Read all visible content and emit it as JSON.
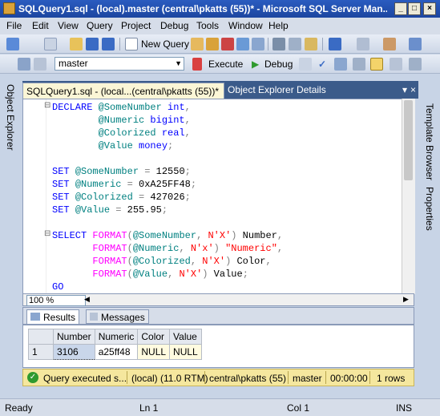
{
  "window": {
    "title": "SQLQuery1.sql - (local).master (central\\pkatts (55))* - Microsoft SQL Server Man..."
  },
  "menu": [
    "File",
    "Edit",
    "View",
    "Query",
    "Project",
    "Debug",
    "Tools",
    "Window",
    "Help"
  ],
  "toolbar": {
    "new_query_label": "New Query",
    "database": "master",
    "execute_label": "Execute",
    "debug_label": "Debug"
  },
  "side_tabs": {
    "object_explorer": "Object Explorer",
    "template_browser": "Template Browser",
    "properties": "Properties"
  },
  "doc_tabs": {
    "active": "SQLQuery1.sql - (local...(central\\pkatts (55))*",
    "inactive": "Object Explorer Details"
  },
  "zoom": "100 %",
  "result_tabs": {
    "results": "Results",
    "messages": "Messages"
  },
  "results": {
    "columns": [
      "Number",
      "Numeric",
      "Color",
      "Value"
    ],
    "rows": [
      {
        "row_num": "1",
        "cells": [
          "3106",
          "a25ff48",
          "NULL",
          "NULL"
        ]
      }
    ]
  },
  "query_status": {
    "message": "Query executed s...",
    "server": "(local) (11.0 RTM)",
    "user": "central\\pkatts (55)",
    "database": "master",
    "elapsed": "00:00:00",
    "rows": "1 rows"
  },
  "statusbar": {
    "ready": "Ready",
    "line": "Ln 1",
    "col": "Col 1",
    "mode": "INS"
  },
  "colors": {
    "keyword": "#0000ff",
    "variable": "#008080",
    "function": "#ff00ff",
    "string": "#ff0000"
  }
}
